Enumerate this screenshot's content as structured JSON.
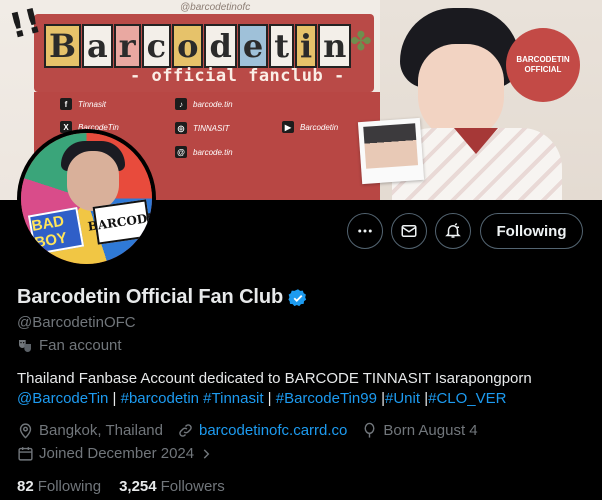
{
  "banner": {
    "watermark": "@barcodetinofc",
    "title_letters": [
      "B",
      "a",
      "r",
      "c",
      "o",
      "d",
      "e",
      "t",
      "i",
      "n"
    ],
    "subtitle": "- official fanclub -",
    "socials": [
      {
        "icon": "facebook-icon",
        "glyph": "f",
        "label": "Tinnasit"
      },
      {
        "icon": "x-icon",
        "glyph": "X",
        "label": "BarcodeTin"
      },
      {
        "icon": "tiktok-icon",
        "glyph": "♪",
        "label": "barcode.tin"
      },
      {
        "icon": "weibo-icon",
        "glyph": "◎",
        "label": "TINNASIT"
      },
      {
        "icon": "threads-icon",
        "glyph": "@",
        "label": "barcode.tin"
      },
      {
        "icon": "youtube-icon",
        "glyph": "▶",
        "label": "Barcodetin"
      }
    ],
    "seal_text": "BARCODETIN OFFICIAL"
  },
  "avatar": {
    "sticker_left": "BAD BOY",
    "sticker_right": "BARCODE"
  },
  "actions": {
    "more_icon": "more-icon",
    "message_icon": "envelope-icon",
    "notify_icon": "bell-icon",
    "following_label": "Following"
  },
  "profile": {
    "name": "Barcodetin Official Fan Club",
    "verified": true,
    "handle": "@BarcodetinOFC",
    "category": "Fan account",
    "bio_text": "Thailand Fanbase Account dedicated to BARCODE TINNASIT Isarapongporn",
    "bio_tags": [
      {
        "text": "@BarcodeTin",
        "sep": " | "
      },
      {
        "text": "#barcodetin #Tinnasit",
        "sep": " | "
      },
      {
        "text": "#BarcodeTin99",
        "sep": " |"
      },
      {
        "text": "#Unit",
        "sep": " |"
      },
      {
        "text": "#CLO_VER",
        "sep": ""
      }
    ],
    "location": "Bangkok, Thailand",
    "website": "barcodetinofc.carrd.co",
    "birthday": "Born August 4",
    "joined": "Joined December 2024",
    "following_count": "82",
    "following_label": "Following",
    "followers_count": "3,254",
    "followers_label": "Followers"
  },
  "colors": {
    "background": "#000000",
    "accent_blue": "#1d9bf0",
    "muted_text": "#71767b",
    "banner_red": "#b94a47"
  }
}
